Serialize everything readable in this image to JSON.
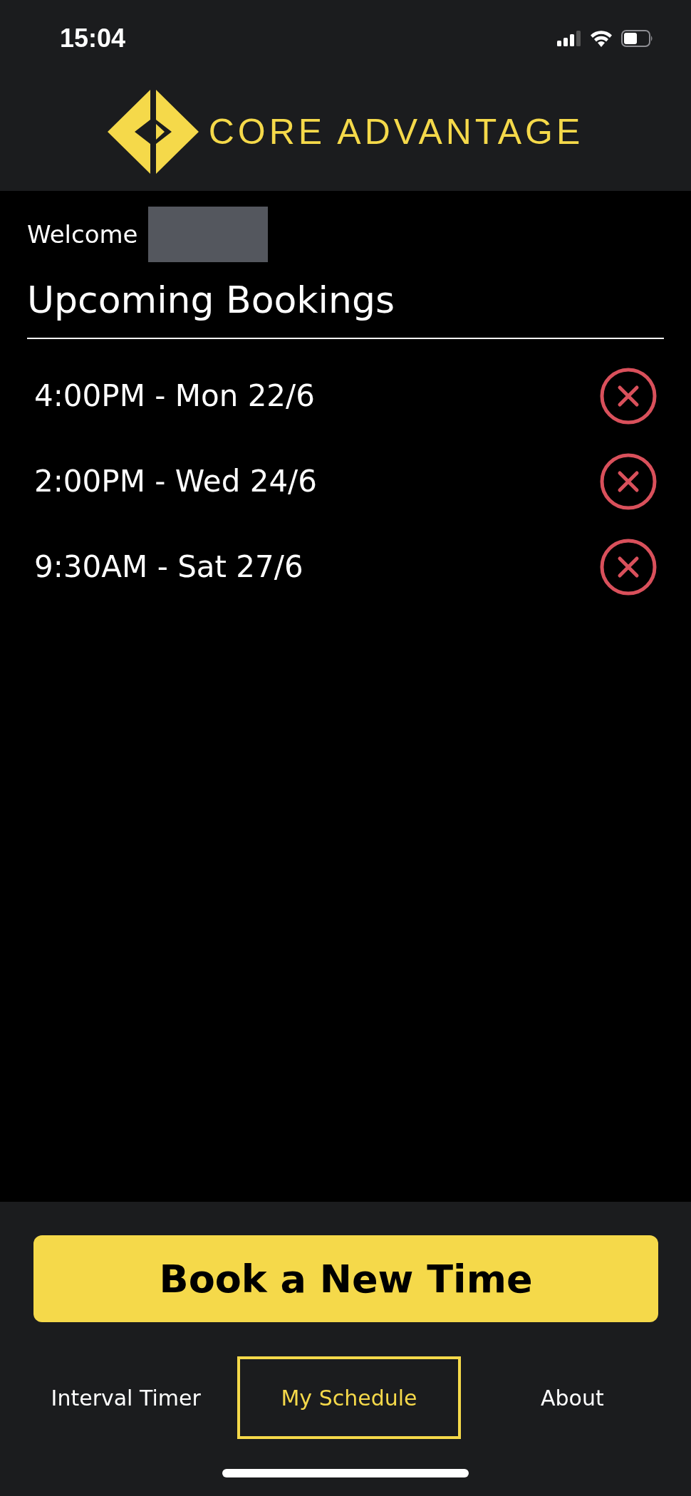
{
  "status_bar": {
    "time": "15:04"
  },
  "header": {
    "logo_text": "CORE ADVANTAGE"
  },
  "welcome": {
    "label": "Welcome"
  },
  "section_title": "Upcoming Bookings",
  "bookings": [
    {
      "label": "4:00PM - Mon 22/6"
    },
    {
      "label": "2:00PM - Wed 24/6"
    },
    {
      "label": "9:30AM - Sat 27/6"
    }
  ],
  "primary_button": "Book a New Time",
  "tabs": [
    {
      "label": "Interval Timer",
      "selected": false
    },
    {
      "label": "My Schedule",
      "selected": true
    },
    {
      "label": "About",
      "selected": false
    }
  ]
}
